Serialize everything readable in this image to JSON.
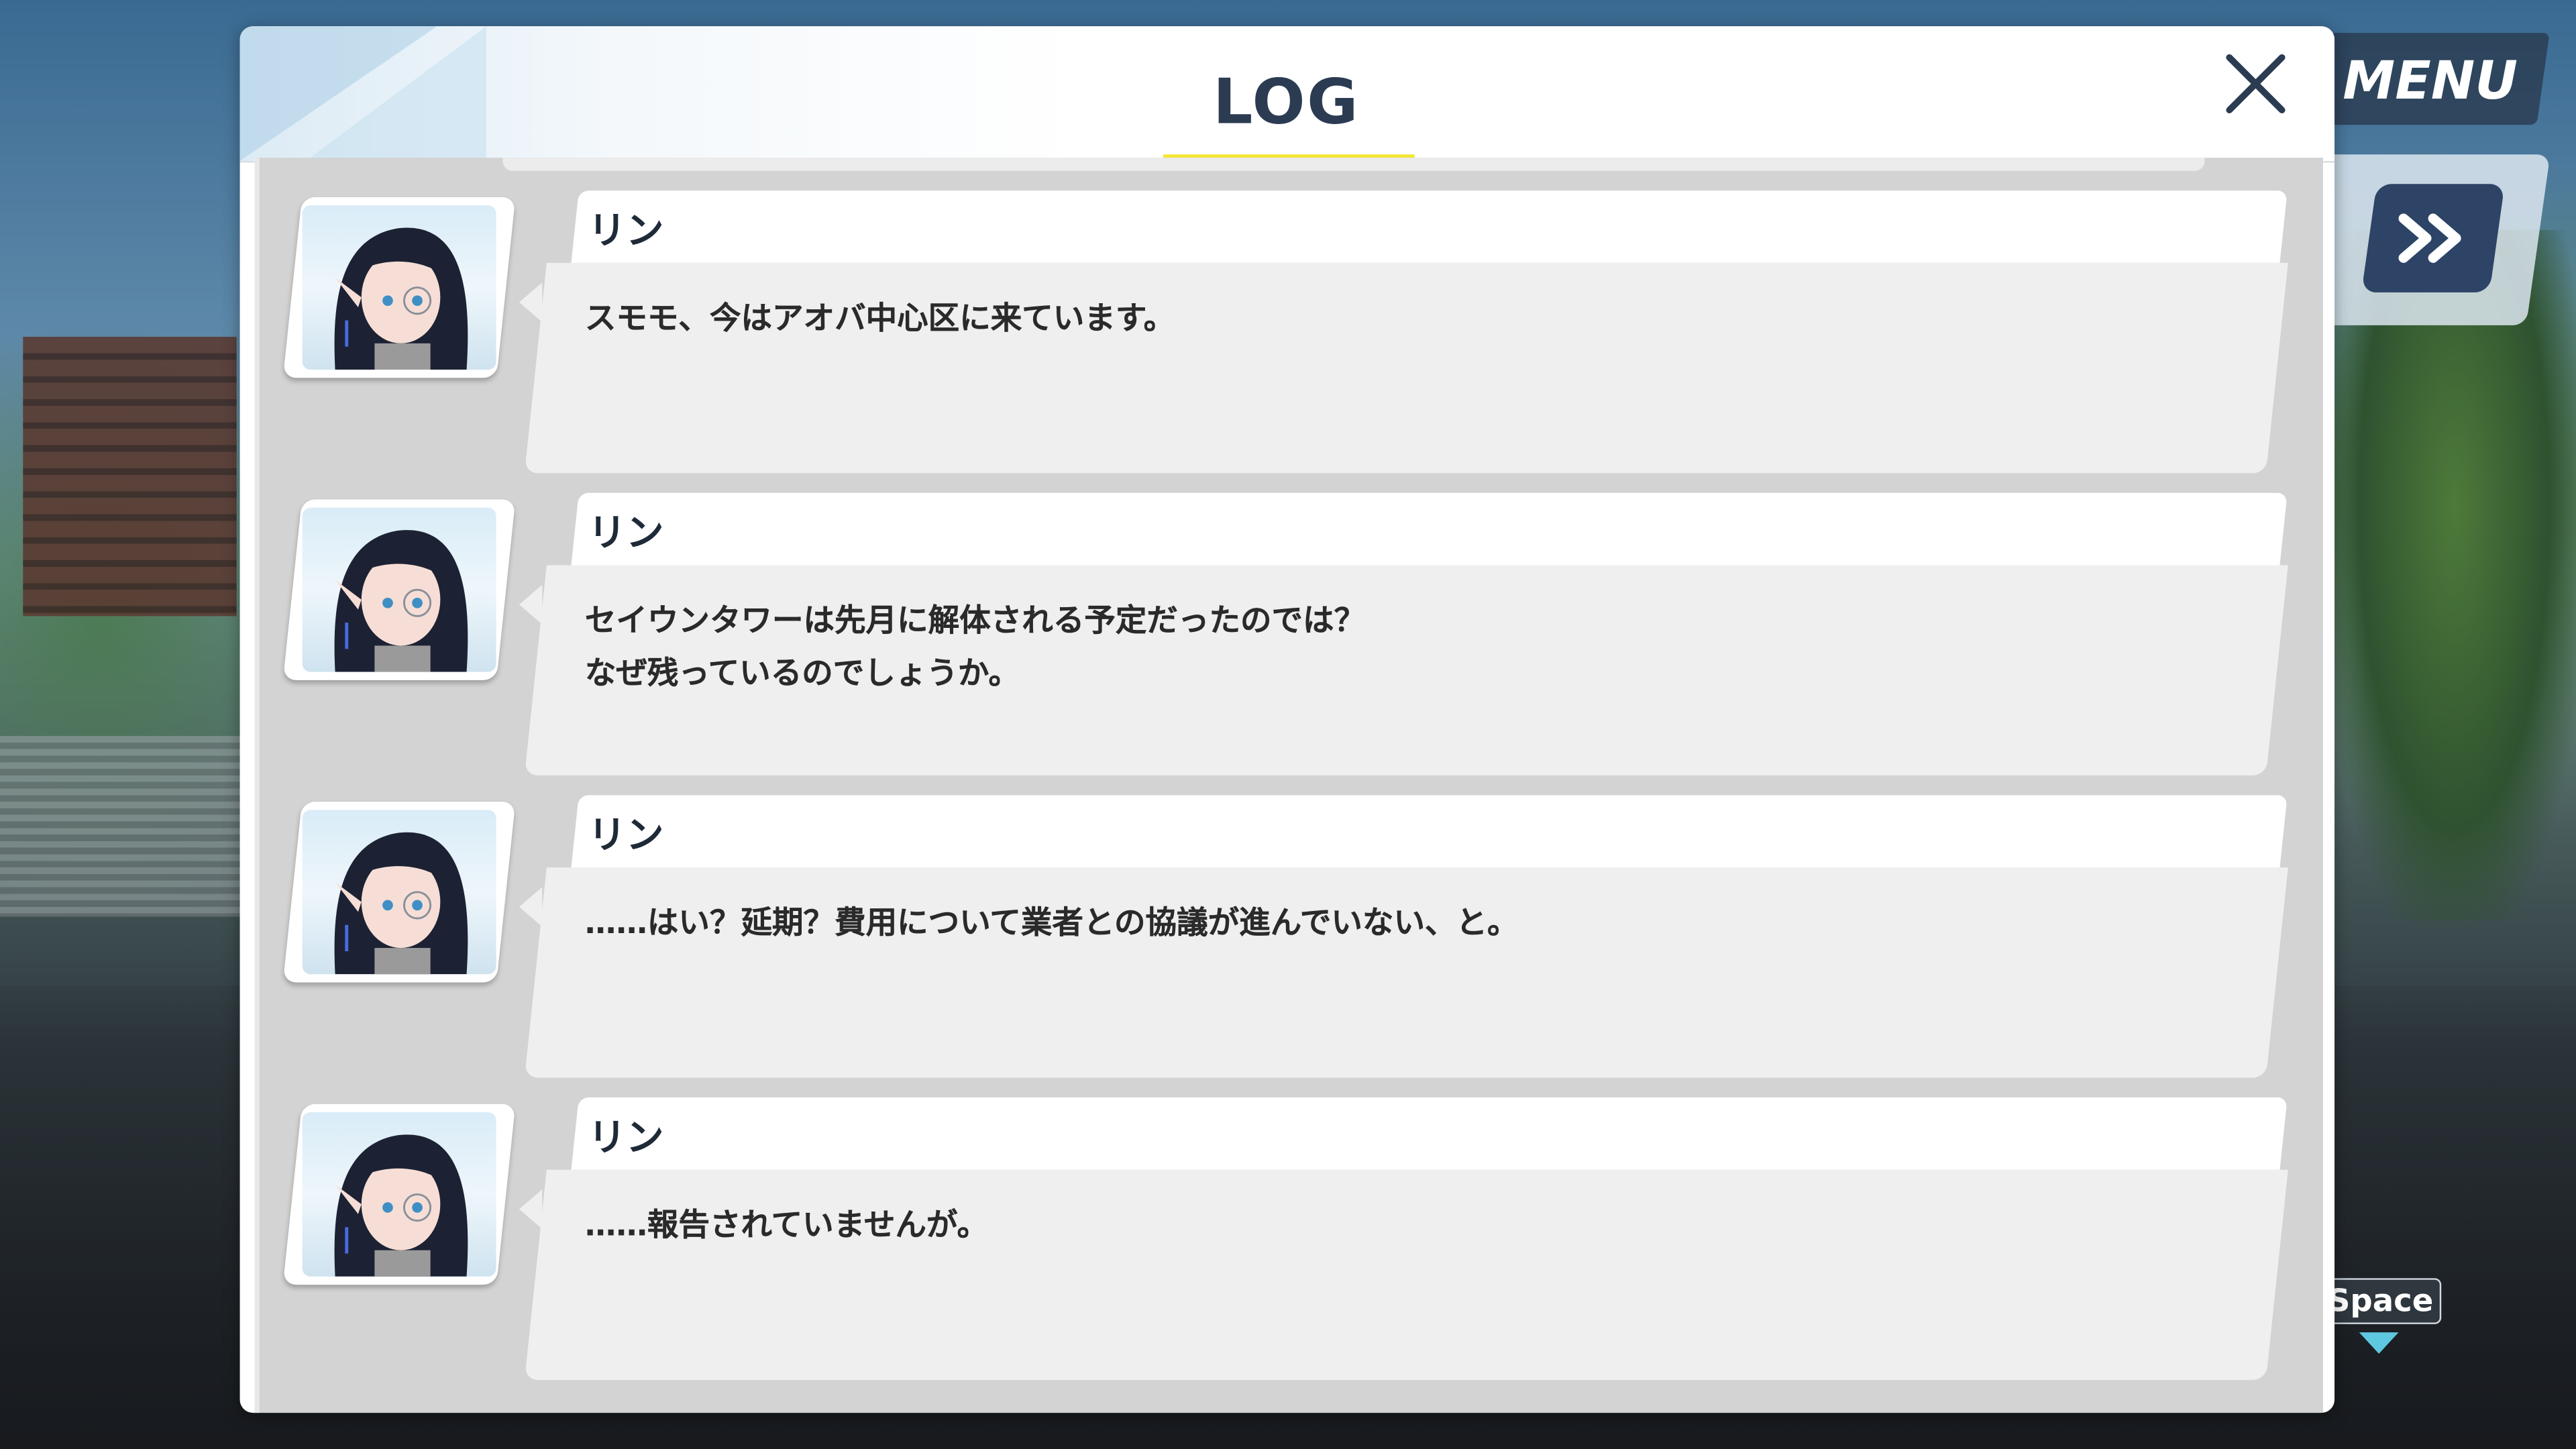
{
  "hud": {
    "menu_label": "MENU",
    "skip_icon": "fast-forward-icon",
    "space_key_label": "Space"
  },
  "log": {
    "title": "LOG",
    "close_icon": "close-icon",
    "entries": [
      {
        "speaker": "リン",
        "portrait": "character-portrait",
        "text": "スモモ、今はアオバ中心区に来ています。"
      },
      {
        "speaker": "リン",
        "portrait": "character-portrait",
        "text": "セイウンタワーは先月に解体される予定だったのでは？\nなぜ残っているのでしょうか。"
      },
      {
        "speaker": "リン",
        "portrait": "character-portrait",
        "text": "……はい？延期？費用について業者との協議が進んでいない、と。"
      },
      {
        "speaker": "リン",
        "portrait": "character-portrait",
        "text": "……報告されていませんが。"
      }
    ]
  },
  "colors": {
    "accent_underline": "#f3e635",
    "title_text": "#2b3b52",
    "skip_button": "#2d4467",
    "space_arrow": "#5ec8e0"
  }
}
